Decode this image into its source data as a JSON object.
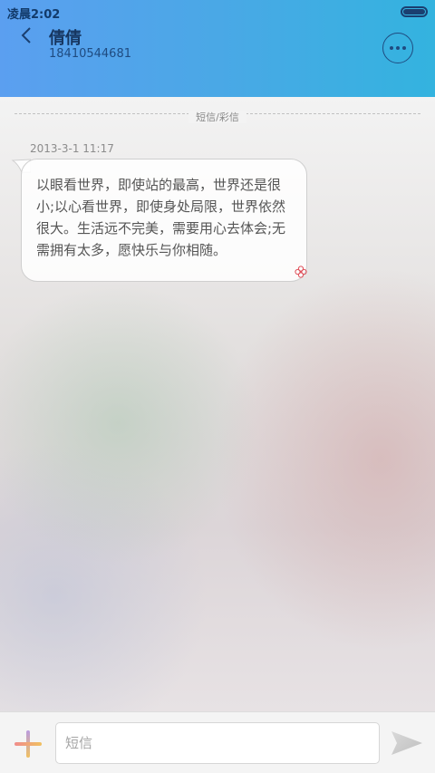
{
  "status_bar": {
    "time": "凌晨2:02"
  },
  "header": {
    "contact_name": "倩倩",
    "contact_number": "18410544681",
    "back_icon": "chevron-left-icon",
    "more_icon": "more-horizontal-icon"
  },
  "conversation": {
    "divider_label": "短信/彩信",
    "messages": [
      {
        "timestamp": "2013-3-1 11:17",
        "lines": [
          "以眼看世界，即使站的最高，世界还是很",
          "小;以心看世界，即使身处局限，世界依然",
          "很大。生活远不完美，需要用心去体会;无",
          "需拥有太多，愿快乐与你相随。"
        ]
      }
    ]
  },
  "composer": {
    "placeholder": "短信",
    "value": "",
    "attach_icon": "plus-icon",
    "send_icon": "send-icon"
  },
  "colors": {
    "header_start": "#5b9ff0",
    "header_end": "#33b3df",
    "text_dark": "#16355f"
  }
}
